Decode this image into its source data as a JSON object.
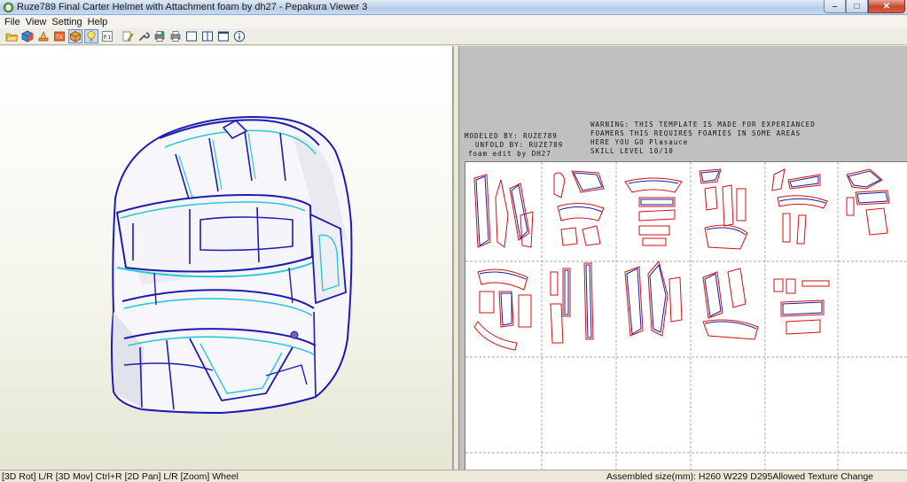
{
  "window": {
    "title": "Ruze789 Final Carter Helmet with Attachment foam by dh27 - Pepakura Viewer 3",
    "minimize_glyph": "–",
    "maximize_glyph": "□",
    "close_glyph": "✕"
  },
  "menu": [
    "File",
    "View",
    "Setting",
    "Help"
  ],
  "toolbar": {
    "icons": [
      "open-folder-icon",
      "cube-icon",
      "unfold-icon",
      "texture-icon",
      "show-3d-icon",
      "light-icon",
      "page-number-icon",
      "edit-icon",
      "settings-wrench-icon",
      "print-icon",
      "print-preview-icon",
      "single-view-icon",
      "split-view-icon",
      "full-view-icon",
      "info-icon"
    ],
    "page_label": "P.1"
  },
  "notes": {
    "modeled_by": "MODELED BY: RUZE789",
    "unfold_by": "UNFOLD BY: RUZE789",
    "foam_edit": "foam edit by DH27",
    "warning_1": "WARNING: THIS TEMPLATE IS MADE FOR EXPERIANCED",
    "warning_2": "FOAMERS THIS REQUIRES FOAMIES IN SOME AREAS",
    "warning_3": "HERE YOU GO Plasauce",
    "warning_4": "SKILL LEVEL 10/10"
  },
  "status": {
    "left": "[3D Rot] L/R [3D Mov] Ctrl+R [2D Pan] L/R [Zoom] Wheel",
    "right": "Assembled size(mm): H260 W229 D295Allowed Texture Change"
  },
  "colors": {
    "cut_line": "#d01010",
    "fold_line": "#1a1aa0",
    "helmet_edge": "#2222b8",
    "helmet_accent": "#28c8d8"
  }
}
